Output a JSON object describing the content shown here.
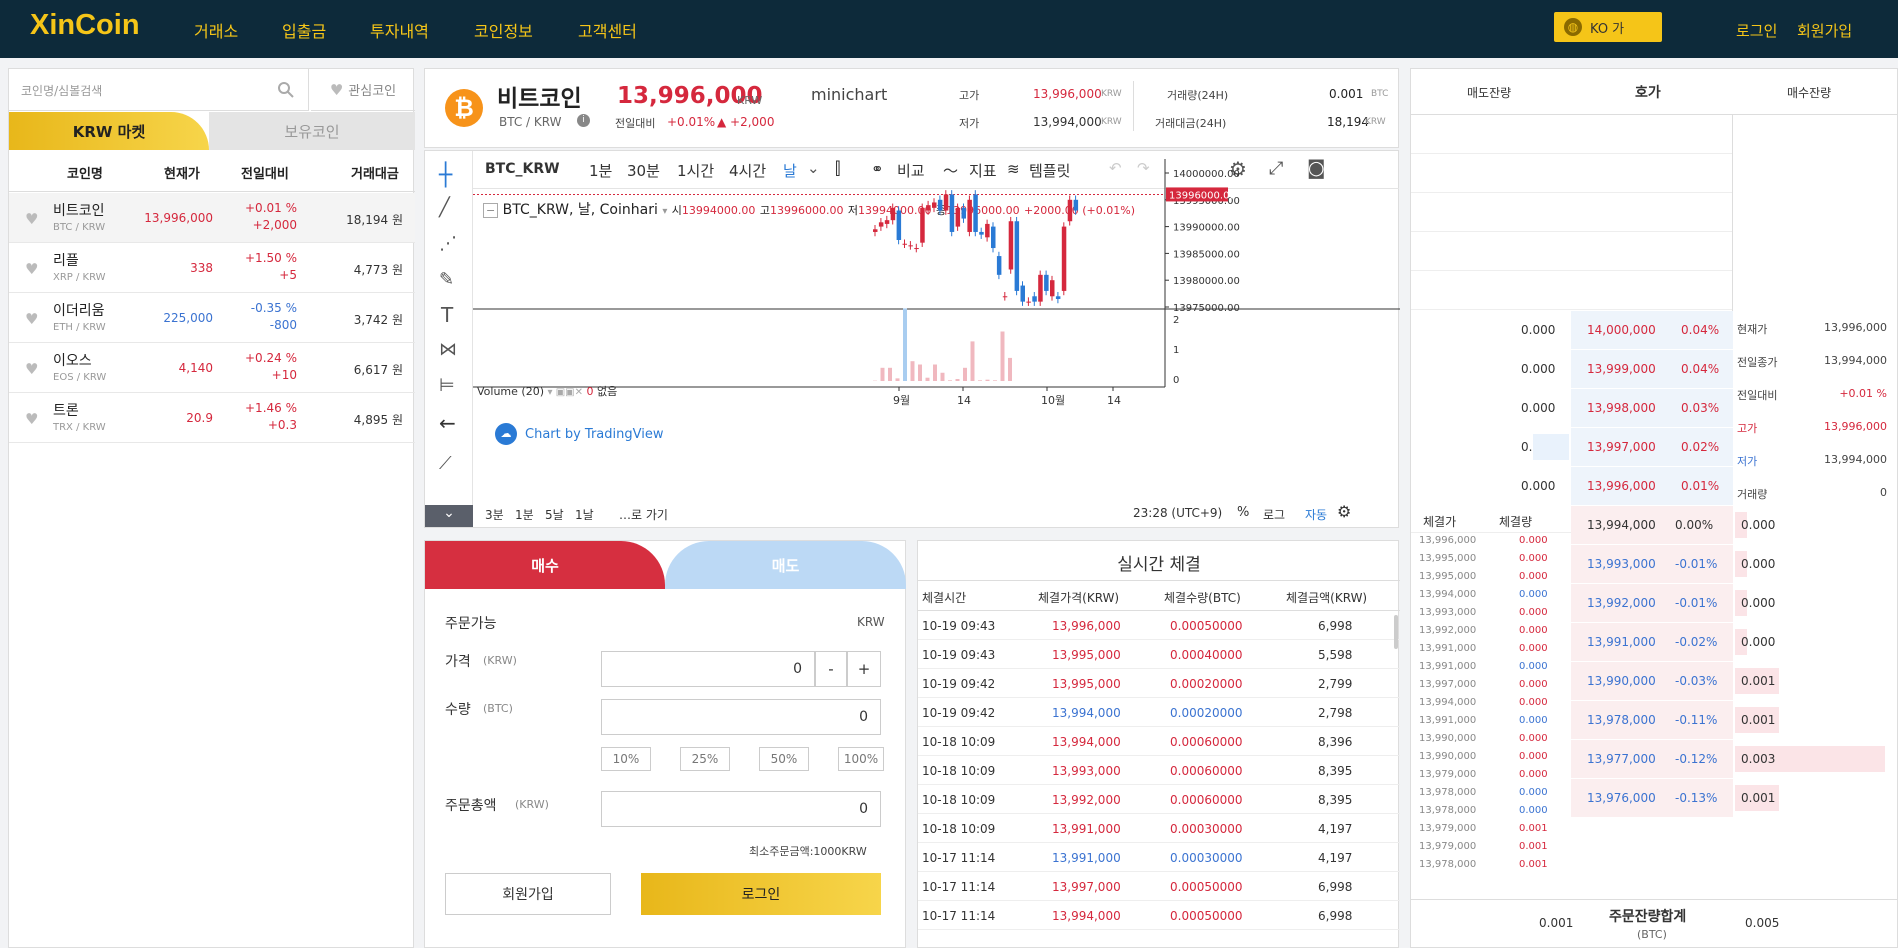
{
  "header": {
    "logo": "XinCoin",
    "nav": [
      "거래소",
      "입출금",
      "투자내역",
      "코인정보",
      "고객센터"
    ],
    "lang": "KO  가",
    "login": "로그인",
    "signup": "회원가입"
  },
  "left": {
    "search_placeholder": "코인명/심볼검색",
    "fav": "관심코인",
    "tab_krw": "KRW 마켓",
    "tab_own": "보유코인",
    "cols": [
      "코인명",
      "현재가",
      "전일대비",
      "거래대금"
    ],
    "coins": [
      {
        "name": "비트코인",
        "sym": "BTC / KRW",
        "price": "13,996,000",
        "pct": "+0.01 %",
        "chg": "+2,000",
        "vol": "18,194 원"
      },
      {
        "name": "리플",
        "sym": "XRP / KRW",
        "price": "338",
        "pct": "+1.50 %",
        "chg": "+5",
        "vol": "4,773 원"
      },
      {
        "name": "이더리움",
        "sym": "ETH / KRW",
        "price": "225,000",
        "pct": "-0.35 %",
        "chg": "-800",
        "vol": "3,742 원"
      },
      {
        "name": "이오스",
        "sym": "EOS / KRW",
        "price": "4,140",
        "pct": "+0.24 %",
        "chg": "+10",
        "vol": "6,617 원"
      },
      {
        "name": "트론",
        "sym": "TRX / KRW",
        "price": "20.9",
        "pct": "+1.46 %",
        "chg": "+0.3",
        "vol": "4,895 원"
      }
    ]
  },
  "ticker": {
    "name": "비트코인",
    "pair": "BTC / KRW",
    "price": "13,996,000",
    "unit": "KRW",
    "chg_label": "전일대비",
    "chg_pct": "+0.01%",
    "chg_abs": "▲ +2,000",
    "mini": "minichart",
    "high_label": "고가",
    "high": "13,996,000",
    "low_label": "저가",
    "low": "13,994,000",
    "krw": "KRW",
    "vol_label": "거래량(24H)",
    "vol": "0.001",
    "btc": "BTC",
    "amt_label": "거래대금(24H)",
    "amt": "18,194"
  },
  "chart": {
    "symbol": "BTC_KRW",
    "intervals": [
      "1분",
      "30분",
      "1시간",
      "4시간",
      "날"
    ],
    "compare": "비교",
    "indicator": "지표",
    "template": "템플릿",
    "legend_title": "BTC_KRW, 날, Coinhari",
    "o_label": "시",
    "o": "13994000.00",
    "h_label": "고",
    "h": "13996000.00",
    "l_label": "저",
    "l": "13994000.00",
    "c_label": "종",
    "c": "13996000.00",
    "chg": "+2000.00 (+0.01%)",
    "price_ticks": [
      "14000000.00",
      "13995000.00",
      "13990000.00",
      "13985000.00",
      "13980000.00",
      "13975000.00"
    ],
    "last_price": "13996000.00",
    "volume_label": "Volume (20)",
    "volume_val": "0",
    "volume_none": "없음",
    "vol_ticks": [
      "2",
      "1",
      "0"
    ],
    "x_ticks": [
      "9월",
      "14",
      "10월",
      "14"
    ],
    "tv": "Chart by TradingView",
    "ranges": [
      "3분",
      "1분",
      "5날",
      "1날"
    ],
    "goto": "…로 가기",
    "time": "23:28 (UTC+9)",
    "pct": "%",
    "log": "로그",
    "auto": "자동"
  },
  "chart_data": {
    "type": "candlestick",
    "series": [
      {
        "o": 13989000,
        "c": 13989500
      },
      {
        "o": 13990000,
        "c": 13990800
      },
      {
        "o": 13990500,
        "c": 13991200
      },
      {
        "o": 13991200,
        "c": 13993500
      },
      {
        "o": 13993000,
        "c": 13987500
      },
      {
        "o": 13986800,
        "c": 13986800
      },
      {
        "o": 13986500,
        "c": 13986500
      },
      {
        "o": 13986000,
        "c": 13986000
      },
      {
        "o": 13987000,
        "c": 13993500
      },
      {
        "o": 13993000,
        "c": 13994000
      },
      {
        "o": 13993500,
        "c": 13994500
      },
      {
        "o": 13995000,
        "c": 13993000
      },
      {
        "o": 13993000,
        "c": 13996000
      },
      {
        "o": 13996000,
        "c": 13989000
      },
      {
        "o": 13990000,
        "c": 13993500
      },
      {
        "o": 13993500,
        "c": 13991500
      },
      {
        "o": 13989000,
        "c": 13995000
      },
      {
        "o": 13996000,
        "c": 13989000
      },
      {
        "o": 13989000,
        "c": 13988500
      },
      {
        "o": 13988000,
        "c": 13990500
      },
      {
        "o": 13990000,
        "c": 13986000
      },
      {
        "o": 13984500,
        "c": 13981000
      },
      {
        "o": 13977000,
        "c": 13977000
      },
      {
        "o": 13982000,
        "c": 13991000
      },
      {
        "o": 13991000,
        "c": 13978000
      },
      {
        "o": 13979000,
        "c": 13976000
      },
      {
        "o": 13976000,
        "c": 13976000
      },
      {
        "o": 13977000,
        "c": 13976000
      },
      {
        "o": 13976000,
        "c": 13981000
      },
      {
        "o": 13981000,
        "c": 13978000
      },
      {
        "o": 13977000,
        "c": 13980000
      },
      {
        "o": 13977000,
        "c": 13976500
      },
      {
        "o": 13978000,
        "c": 13990000
      },
      {
        "o": 13991000,
        "c": 13995000
      },
      {
        "o": 13995000,
        "c": 13993000
      }
    ],
    "volumes": [
      0.01,
      0.4,
      0.4,
      0.08,
      2.2,
      0.6,
      0.5,
      0.1,
      0.5,
      0.25,
      0.02,
      0.06,
      0.4,
      1.2,
      0.02,
      0.04,
      0.02,
      1.5,
      0.7
    ],
    "ylim": [
      13975000,
      14000000
    ]
  },
  "order": {
    "buy": "매수",
    "sell": "매도",
    "avail": "주문가능",
    "avail_unit": "KRW",
    "price": "가격",
    "price_unit": "(KRW)",
    "price_val": "0",
    "minus": "-",
    "plus": "+",
    "qty": "수량",
    "qty_unit": "(BTC)",
    "qty_val": "0",
    "pcts": [
      "10%",
      "25%",
      "50%",
      "100%"
    ],
    "total": "주문총액",
    "total_unit": "(KRW)",
    "total_val": "0",
    "min": "최소주문금액:1000KRW",
    "signup": "회원가입",
    "login": "로그인"
  },
  "trades": {
    "title": "실시간 체결",
    "cols": [
      "체결시간",
      "체결가격(KRW)",
      "체결수량(BTC)",
      "체결금액(KRW)"
    ],
    "rows": [
      [
        "10-19 09:43",
        "13,996,000",
        "0.00050000",
        "6,998",
        "r"
      ],
      [
        "10-19 09:43",
        "13,995,000",
        "0.00040000",
        "5,598",
        "r"
      ],
      [
        "10-19 09:42",
        "13,995,000",
        "0.00020000",
        "2,799",
        "r"
      ],
      [
        "10-19 09:42",
        "13,994,000",
        "0.00020000",
        "2,798",
        "b"
      ],
      [
        "10-18 10:09",
        "13,994,000",
        "0.00060000",
        "8,396",
        "r"
      ],
      [
        "10-18 10:09",
        "13,993,000",
        "0.00060000",
        "8,395",
        "r"
      ],
      [
        "10-18 10:09",
        "13,992,000",
        "0.00060000",
        "8,395",
        "r"
      ],
      [
        "10-18 10:09",
        "13,991,000",
        "0.00030000",
        "4,197",
        "r"
      ],
      [
        "10-17 11:14",
        "13,991,000",
        "0.00030000",
        "4,197",
        "b"
      ],
      [
        "10-17 11:14",
        "13,997,000",
        "0.00050000",
        "6,998",
        "r"
      ],
      [
        "10-17 11:14",
        "13,994,000",
        "0.00050000",
        "6,998",
        "r"
      ]
    ]
  },
  "book": {
    "ask_label": "매도잔량",
    "title": "호가",
    "bid_label": "매수잔량",
    "asks": [
      [
        "0.000",
        "14,000,000",
        "0.04%"
      ],
      [
        "0.000",
        "13,999,000",
        "0.04%"
      ],
      [
        "0.000",
        "13,998,000",
        "0.03%"
      ],
      [
        "0.001",
        "13,997,000",
        "0.02%"
      ],
      [
        "0.000",
        "13,996,000",
        "0.01%"
      ]
    ],
    "bids": [
      [
        "13,994,000",
        "0.00%",
        "0.000"
      ],
      [
        "13,993,000",
        "-0.01%",
        "0.000"
      ],
      [
        "13,992,000",
        "-0.01%",
        "0.000"
      ],
      [
        "13,991,000",
        "-0.02%",
        "0.000"
      ],
      [
        "13,990,000",
        "-0.03%",
        "0.001"
      ],
      [
        "13,978,000",
        "-0.11%",
        "0.001"
      ],
      [
        "13,977,000",
        "-0.12%",
        "0.003"
      ],
      [
        "13,976,000",
        "-0.13%",
        "0.001"
      ]
    ],
    "info": [
      [
        "현재가",
        "13,996,000"
      ],
      [
        "전일종가",
        "13,994,000"
      ],
      [
        "전일대비",
        "+0.01 %"
      ],
      [
        "고가",
        "13,996,000"
      ],
      [
        "저가",
        "13,994,000"
      ],
      [
        "거래량",
        "0"
      ]
    ],
    "fills_cols": [
      "체결가",
      "체결량"
    ],
    "fills": [
      [
        "13,996,000",
        "0.000",
        "r"
      ],
      [
        "13,995,000",
        "0.000",
        "r"
      ],
      [
        "13,995,000",
        "0.000",
        "r"
      ],
      [
        "13,994,000",
        "0.000",
        "b"
      ],
      [
        "13,993,000",
        "0.000",
        "r"
      ],
      [
        "13,992,000",
        "0.000",
        "r"
      ],
      [
        "13,991,000",
        "0.000",
        "r"
      ],
      [
        "13,991,000",
        "0.000",
        "b"
      ],
      [
        "13,997,000",
        "0.000",
        "r"
      ],
      [
        "13,994,000",
        "0.000",
        "r"
      ],
      [
        "13,991,000",
        "0.000",
        "b"
      ],
      [
        "13,990,000",
        "0.000",
        "r"
      ],
      [
        "13,990,000",
        "0.000",
        "r"
      ],
      [
        "13,979,000",
        "0.000",
        "r"
      ],
      [
        "13,978,000",
        "0.000",
        "b"
      ],
      [
        "13,978,000",
        "0.000",
        "b"
      ],
      [
        "13,979,000",
        "0.001",
        "r"
      ],
      [
        "13,979,000",
        "0.001",
        "r"
      ],
      [
        "13,978,000",
        "0.001",
        "r"
      ]
    ],
    "total_label": "주문잔량합계",
    "total_unit": "(BTC)",
    "total_ask": "0.001",
    "total_bid": "0.005"
  }
}
